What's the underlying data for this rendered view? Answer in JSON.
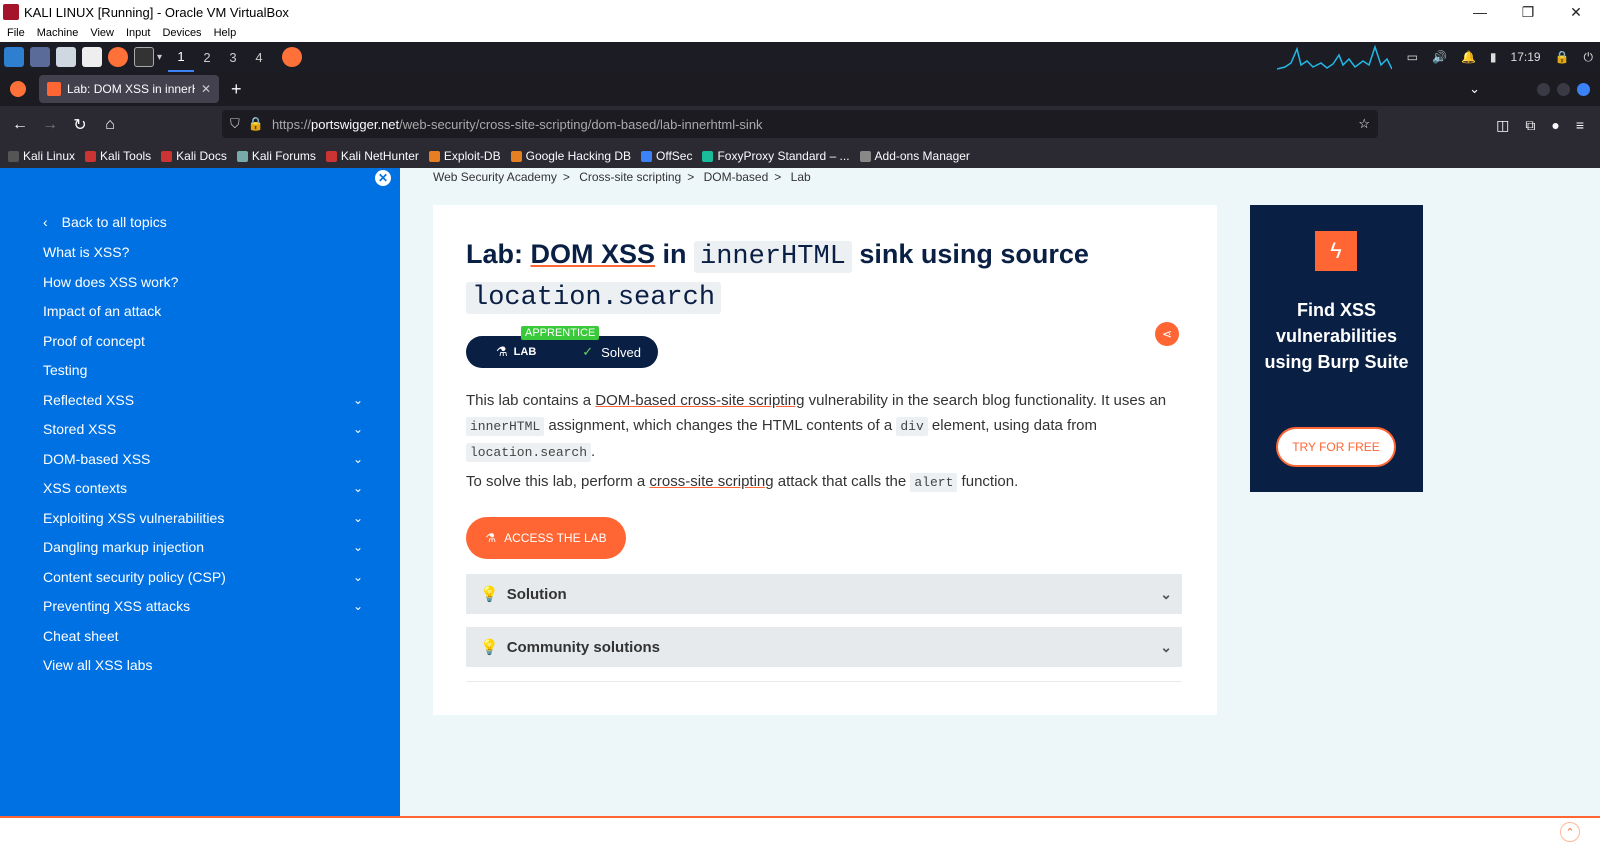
{
  "window": {
    "title": "KALI LINUX [Running] - Oracle VM VirtualBox",
    "controls": [
      "—",
      "❐",
      "✕"
    ],
    "menu": [
      "File",
      "Machine",
      "View",
      "Input",
      "Devices",
      "Help"
    ]
  },
  "panel": {
    "workspaces": [
      "1",
      "2",
      "3",
      "4"
    ],
    "clock": "17:19"
  },
  "browser": {
    "tab_title": "Lab: DOM XSS in innerHT",
    "url_prefix": "https://",
    "url_host": "portswigger.net",
    "url_path": "/web-security/cross-site-scripting/dom-based/lab-innerhtml-sink",
    "bookmarks": [
      "Kali Linux",
      "Kali Tools",
      "Kali Docs",
      "Kali Forums",
      "Kali NetHunter",
      "Exploit-DB",
      "Google Hacking DB",
      "OffSec",
      "FoxyProxy Standard – ...",
      "Add-ons Manager"
    ]
  },
  "sidebar": {
    "back": "Back to all topics",
    "items": [
      {
        "label": "What is XSS?",
        "expandable": false
      },
      {
        "label": "How does XSS work?",
        "expandable": false
      },
      {
        "label": "Impact of an attack",
        "expandable": false
      },
      {
        "label": "Proof of concept",
        "expandable": false
      },
      {
        "label": "Testing",
        "expandable": false
      },
      {
        "label": "Reflected XSS",
        "expandable": true
      },
      {
        "label": "Stored XSS",
        "expandable": true
      },
      {
        "label": "DOM-based XSS",
        "expandable": true
      },
      {
        "label": "XSS contexts",
        "expandable": true
      },
      {
        "label": "Exploiting XSS vulnerabilities",
        "expandable": true
      },
      {
        "label": "Dangling markup injection",
        "expandable": true
      },
      {
        "label": "Content security policy (CSP)",
        "expandable": true
      },
      {
        "label": "Preventing XSS attacks",
        "expandable": true
      },
      {
        "label": "Cheat sheet",
        "expandable": false
      },
      {
        "label": "View all XSS labs",
        "expandable": false
      }
    ]
  },
  "breadcrumb": [
    "Web Security Academy",
    "Cross-site scripting",
    "DOM-based",
    "Lab"
  ],
  "lab": {
    "title_prefix": "Lab: ",
    "title_link": "DOM XSS",
    "title_in": " in ",
    "title_code1": "innerHTML",
    "title_mid": " sink using source ",
    "title_code2": "location.search",
    "level": "APPRENTICE",
    "type": "LAB",
    "status": "Solved",
    "p1_a": "This lab contains a ",
    "p1_link": "DOM-based cross-site scripting",
    "p1_b": " vulnerability in the search blog functionality. It uses an ",
    "p1_code1": "innerHTML",
    "p1_c": " assignment, which changes the HTML contents of a ",
    "p1_code2": "div",
    "p1_d": " element, using data from ",
    "p1_code3": "location.search",
    "p1_e": ".",
    "p2_a": "To solve this lab, perform a ",
    "p2_link": "cross-site scripting",
    "p2_b": " attack that calls the ",
    "p2_code": "alert",
    "p2_c": " function.",
    "access_button": "ACCESS THE LAB",
    "accordion": [
      "Solution",
      "Community solutions"
    ]
  },
  "ad": {
    "headline": "Find XSS vulnerabilities using Burp Suite",
    "button": "TRY FOR FREE"
  },
  "colors": {
    "accent": "#ff6633",
    "sidebar": "#0071e3",
    "navy": "#0a1f44"
  }
}
